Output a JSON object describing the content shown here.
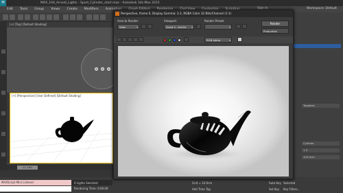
{
  "app": {
    "title": "MAX_104_Arnold_Lights - Sport_Cylinder_start.max - Autodesk 3ds Max 2015",
    "signin": "Sign In",
    "workspace": "Workspace: Default"
  },
  "menu": [
    "Edit",
    "Tools",
    "Group",
    "Views",
    "Create",
    "Modifiers",
    "Animation",
    "Graph Editors",
    "Rendering",
    "Civil View",
    "Customize",
    "Scripting"
  ],
  "viewport_top_label": "[+] [Top] [Default Shading]",
  "viewport_persp_label": "[+] [Perspective] [User Defined] [Default Shading]",
  "timeline": {
    "frame": "0 / 100"
  },
  "status": {
    "listener": "MAXScript Mini Listener",
    "lights_selected": "0 Lights Selected",
    "rendering_time": "Rendering Time: 0:00:09",
    "grid": "Grid = 10.0cm",
    "add_time_tag": "Add Time Tag",
    "auto_key": "Auto Key",
    "set_key": "Set Key",
    "selected": "Selected",
    "key_filters": "Key Filters..."
  },
  "render_frame": {
    "title": "Perspective, frame 0, Display Gamma: 2.2, RGBA Color 32 Bits/Channel (1:1)",
    "area_label": "Area to Render:",
    "area_value": "View",
    "viewport_label": "Viewport:",
    "viewport_value": "Quad 4 - Active",
    "preset_label": "Render Preset:",
    "render_button": "Render",
    "production_value": "Production",
    "channel_value": "RGB Alpha"
  },
  "command_panel": {
    "rows": [
      "Targeted",
      "Cylinder",
      "1.5",
      "100.0cm"
    ]
  },
  "colors": {
    "accent_orange": "#d46d1a",
    "selection_blue": "#2d5e9e",
    "viewport_border": "#e0b400"
  },
  "icons": [
    "app-logo-icon",
    "render-frame-icon",
    "teapot-render",
    "teapot-silhouette",
    "light-gizmo"
  ]
}
